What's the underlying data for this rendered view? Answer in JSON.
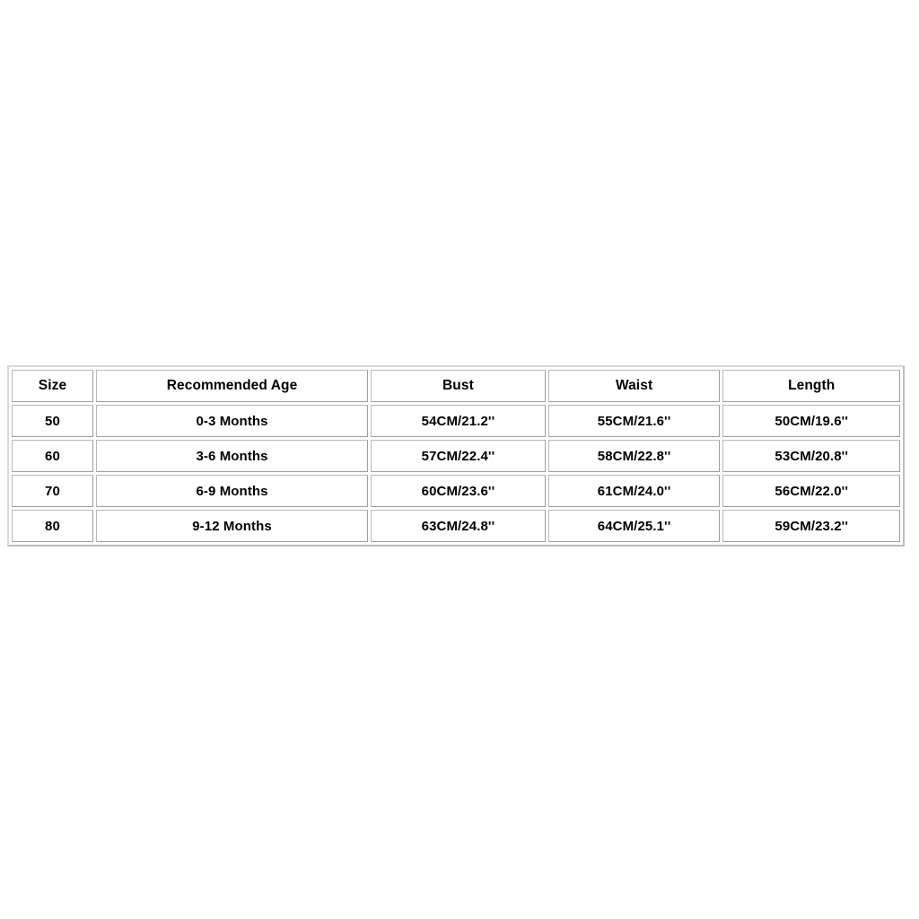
{
  "chart_data": {
    "type": "table",
    "title": "",
    "columns": [
      "Size",
      "Recommended Age",
      "Bust",
      "Waist",
      "Length"
    ],
    "rows": [
      [
        "50",
        "0-3 Months",
        "54CM/21.2''",
        "55CM/21.6''",
        "50CM/19.6''"
      ],
      [
        "60",
        "3-6 Months",
        "57CM/22.4''",
        "58CM/22.8''",
        "53CM/20.8''"
      ],
      [
        "70",
        "6-9 Months",
        "60CM/23.6''",
        "61CM/24.0''",
        "56CM/22.0''"
      ],
      [
        "80",
        "9-12 Months",
        "63CM/24.8''",
        "64CM/25.1''",
        "59CM/23.2''"
      ]
    ]
  },
  "table": {
    "headers": {
      "size": "Size",
      "age": "Recommended Age",
      "bust": "Bust",
      "waist": "Waist",
      "length": "Length"
    },
    "rows": [
      {
        "size": "50",
        "age": "0-3 Months",
        "bust": "54CM/21.2''",
        "waist": "55CM/21.6''",
        "length": "50CM/19.6''"
      },
      {
        "size": "60",
        "age": "3-6 Months",
        "bust": "57CM/22.4''",
        "waist": "58CM/22.8''",
        "length": "53CM/20.8''"
      },
      {
        "size": "70",
        "age": "6-9 Months",
        "bust": "60CM/23.6''",
        "waist": "61CM/24.0''",
        "length": "56CM/22.0''"
      },
      {
        "size": "80",
        "age": "9-12 Months",
        "bust": "63CM/24.8''",
        "waist": "64CM/25.1''",
        "length": "59CM/23.2''"
      }
    ]
  },
  "colors": {
    "background": "#ffffff",
    "text": "#000000",
    "cell_border": "#a8a8a8",
    "table_border": "#c9c9c9"
  }
}
